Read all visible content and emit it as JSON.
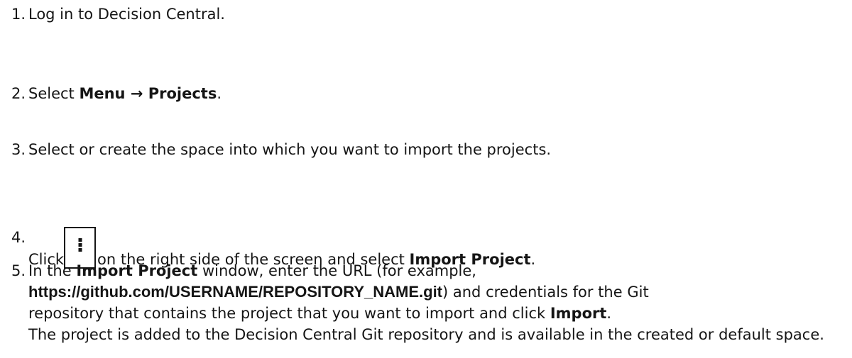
{
  "steps": [
    {
      "num": "1.",
      "text": "Log in to Decision Central."
    },
    {
      "num": "2.",
      "pre": "Select ",
      "bold": "Menu → Projects",
      "post": "."
    },
    {
      "num": "3.",
      "text": "Select or create the space into which you want to import the projects."
    },
    {
      "num": "4.",
      "pre": "Click",
      "icon": "kebab-menu-icon",
      "mid": "on the right side of the screen and select ",
      "bold": "Import Project",
      "post": "."
    },
    {
      "num": "5.",
      "l1_pre": "In the ",
      "l1_bold": "Import Project",
      "l1_post": " window, enter the URL (for example,",
      "url": "https://github.com/USERNAME/REPOSITORY_NAME.git",
      "l2_post": ") and credentials for the Git",
      "l3_pre": "repository that contains the project that you want to import and click ",
      "l3_bold": "Import",
      "l3_post": ".",
      "result": "The project is added to the Decision Central Git repository and is available in the created or default space."
    }
  ]
}
